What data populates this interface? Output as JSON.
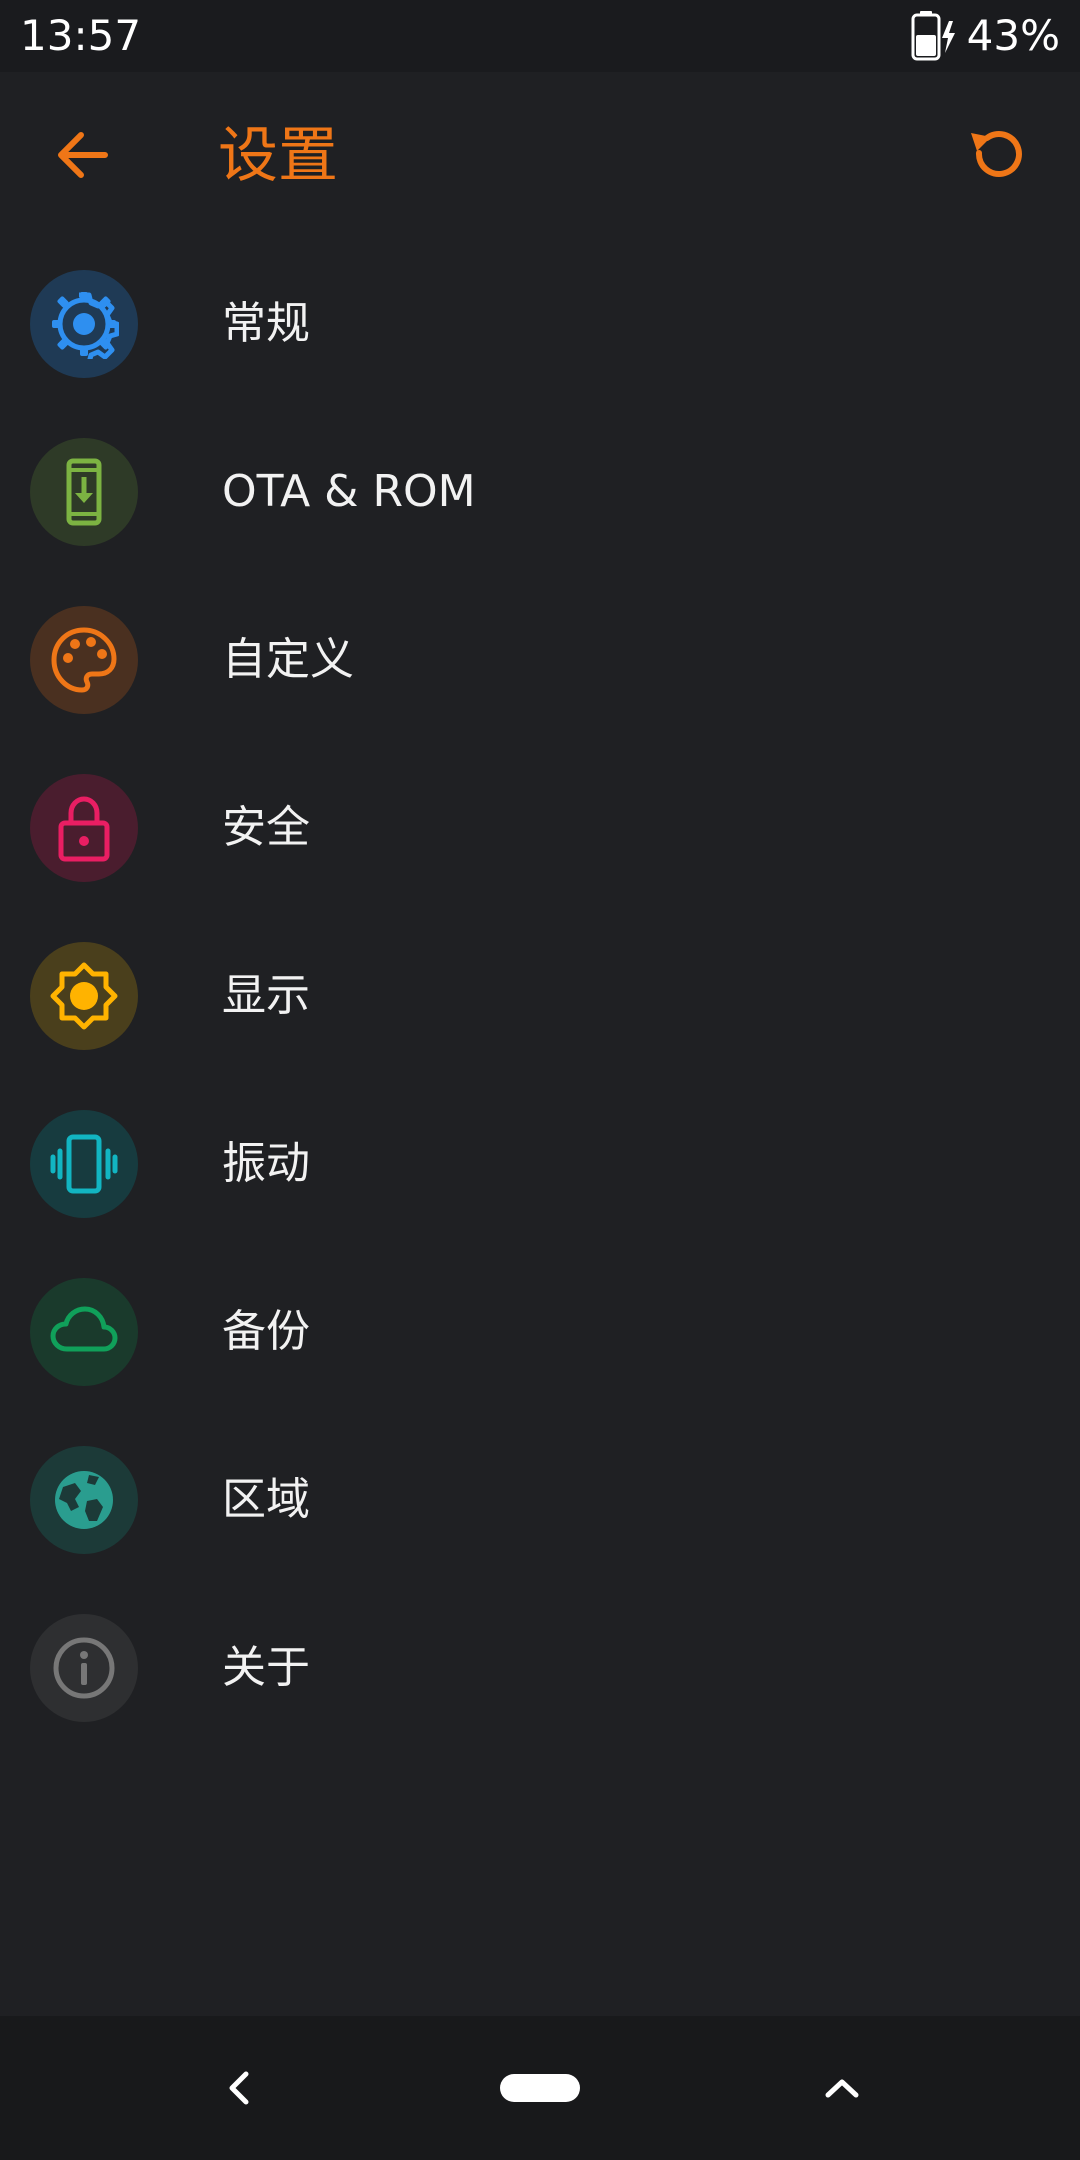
{
  "status_bar": {
    "time": "13:57",
    "battery_percent": "43%",
    "battery_icon": "battery-charging-icon"
  },
  "app_bar": {
    "title": "设置",
    "back_icon": "arrow-back-icon",
    "reset_icon": "refresh-icon",
    "accent_color": "#ef7617"
  },
  "menu": {
    "items": [
      {
        "label": "常规",
        "icon": "gear-icon",
        "color": "#2e8ff0",
        "bg": "#1f3a55"
      },
      {
        "label": "OTA & ROM",
        "icon": "phone-download-icon",
        "color": "#7cb342",
        "bg": "#2e3a27"
      },
      {
        "label": "自定义",
        "icon": "palette-icon",
        "color": "#ef7617",
        "bg": "#4a3020"
      },
      {
        "label": "安全",
        "icon": "lock-icon",
        "color": "#e91e63",
        "bg": "#4a1d2e"
      },
      {
        "label": "显示",
        "icon": "brightness-icon",
        "color": "#ffb300",
        "bg": "#4a3f1c"
      },
      {
        "label": "振动",
        "icon": "vibration-icon",
        "color": "#12b5c2",
        "bg": "#173b3f"
      },
      {
        "label": "备份",
        "icon": "cloud-icon",
        "color": "#10a05a",
        "bg": "#1a3a2c"
      },
      {
        "label": "区域",
        "icon": "globe-icon",
        "color": "#2a9d8f",
        "bg": "#1c3a38"
      },
      {
        "label": "关于",
        "icon": "info-icon",
        "color": "#777777",
        "bg": "#2e2f31"
      }
    ]
  },
  "nav_bar": {
    "back_icon": "chevron-left-icon",
    "home_icon": "home-pill-icon",
    "recents_icon": "chevron-up-icon"
  }
}
